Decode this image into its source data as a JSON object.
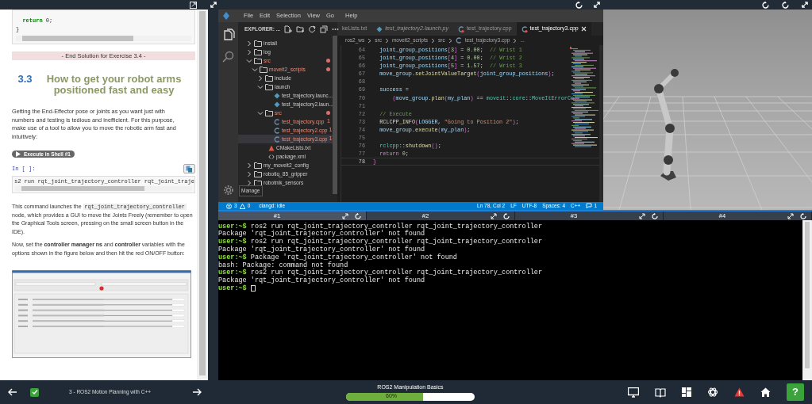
{
  "notebook": {
    "code_top": [
      [
        {
          "kind": "keyword",
          "text": "  return"
        },
        {
          "kind": "plain",
          "text": " 0;"
        }
      ],
      [
        {
          "kind": "plain",
          "text": "}"
        }
      ]
    ],
    "banner": "- End Solution for Exercise 3.4 -",
    "heading": {
      "number": "3.3",
      "title": "How to get your robot arms positioned fast and easy"
    },
    "paragraph_1": "Getting the End-Effector pose or joints as you want just with numbers and testing is tedious and inefficient. For this purpose, make use of a tool to allow you to move the robotic arm fast and intuitively:",
    "run_button": "Execute in Shell #1",
    "cell_prompt": "In [ ]:",
    "cell_code": "s2 run rqt_joint_trajectory_controller rqt_joint_traje",
    "paragraph_2": {
      "before": "This command launches the",
      "code": "rqt_joint_trajectory_controller",
      "after": "node, which provides a GUI to move the Joints Freely (remember to open the Graphical Tools screen, pressing on the small screen button in the IDE)."
    },
    "paragraph_3": "Now, set the **controller manager ns** and **controller** variables with the options shown in the figure below and then hit the red ON/OFF button:"
  },
  "ide": {
    "menu": [
      "File",
      "Edit",
      "Selection",
      "View",
      "Go",
      "Help"
    ],
    "explorer_title": "EXPLORER: ...",
    "tree": [
      {
        "label": "install",
        "kind": "folder",
        "expanded": false,
        "error": false,
        "selected": false
      },
      {
        "label": "log",
        "kind": "folder",
        "expanded": false,
        "error": false,
        "selected": false
      },
      {
        "label": "src",
        "kind": "folder",
        "expanded": true,
        "error": true,
        "selected": false,
        "children": [
          {
            "label": "moveit2_scripts",
            "kind": "folder",
            "expanded": true,
            "error": true,
            "selected": false,
            "children": [
              {
                "label": "include",
                "kind": "folder",
                "expanded": false,
                "error": false,
                "selected": false
              },
              {
                "label": "launch",
                "kind": "folder",
                "expanded": true,
                "error": false,
                "selected": false,
                "children": [
                  {
                    "label": "test_trajectory.launc...",
                    "kind": "launch",
                    "error": false,
                    "selected": false
                  },
                  {
                    "label": "test_trajectory2.laun...",
                    "kind": "launch",
                    "error": false,
                    "selected": false
                  }
                ]
              },
              {
                "label": "src",
                "kind": "folder",
                "expanded": true,
                "error": true,
                "selected": false,
                "children": [
                  {
                    "label": "test_trajectory.cpp",
                    "kind": "cpp",
                    "error": true,
                    "badge": "1",
                    "selected": false
                  },
                  {
                    "label": "test_trajectory2.cpp",
                    "kind": "cpp",
                    "error": true,
                    "badge": "1",
                    "selected": false
                  },
                  {
                    "label": "test_trajectory3.cpp",
                    "kind": "cpp",
                    "error": true,
                    "badge": "1",
                    "selected": true
                  }
                ]
              },
              {
                "label": "CMakeLists.txt",
                "kind": "cmake",
                "error": false,
                "selected": false
              },
              {
                "label": "package.xml",
                "kind": "xml",
                "error": false,
                "selected": false
              }
            ]
          }
        ]
      },
      {
        "label": "my_moveit2_config",
        "kind": "folder",
        "expanded": false,
        "error": false,
        "selected": false
      },
      {
        "label": "robotiq_85_gripper",
        "kind": "folder",
        "expanded": false,
        "error": false,
        "selected": false
      },
      {
        "label": "robotnik_sensors",
        "kind": "folder",
        "expanded": false,
        "error": false,
        "selected": false
      }
    ],
    "tooltip": "Manage",
    "tabs": [
      {
        "label": "keLists.txt",
        "preview": false,
        "selected": false
      },
      {
        "label": "test_trajectory2.launch.py",
        "kind": "launch",
        "preview": true,
        "error": false,
        "selected": false
      },
      {
        "label": "test_trajectory.cpp",
        "kind": "cpp",
        "preview": false,
        "error": true,
        "selected": false
      },
      {
        "label": "test_trajectory3.cpp",
        "kind": "cpp",
        "preview": false,
        "error": true,
        "selected": true
      }
    ],
    "breadcrumb": [
      "ros2_ws",
      "src",
      "moveit2_scripts",
      "src",
      "test_trajectory3.cpp",
      "..."
    ],
    "code": [
      {
        "number": "64",
        "current": false,
        "segments": [
          {
            "kind": "var",
            "text": "  joint_group_positions"
          },
          {
            "kind": "bracket",
            "text": "["
          },
          {
            "kind": "num",
            "text": "3"
          },
          {
            "kind": "bracket",
            "text": "]"
          },
          {
            "kind": "op",
            "text": " = "
          },
          {
            "kind": "num",
            "text": "0.00"
          },
          {
            "kind": "op",
            "text": ";  "
          },
          {
            "kind": "comment",
            "text": "// Wrist 1"
          }
        ]
      },
      {
        "number": "65",
        "current": false,
        "segments": [
          {
            "kind": "var",
            "text": "  joint_group_positions"
          },
          {
            "kind": "bracket",
            "text": "["
          },
          {
            "kind": "num",
            "text": "4"
          },
          {
            "kind": "bracket",
            "text": "]"
          },
          {
            "kind": "op",
            "text": " = "
          },
          {
            "kind": "num",
            "text": "0.00"
          },
          {
            "kind": "op",
            "text": ";  "
          },
          {
            "kind": "comment",
            "text": "// Wrist 2"
          }
        ]
      },
      {
        "number": "66",
        "current": false,
        "segments": [
          {
            "kind": "var",
            "text": "  joint_group_positions"
          },
          {
            "kind": "bracket",
            "text": "["
          },
          {
            "kind": "num",
            "text": "5"
          },
          {
            "kind": "bracket",
            "text": "]"
          },
          {
            "kind": "op",
            "text": " = "
          },
          {
            "kind": "num",
            "text": "1.57"
          },
          {
            "kind": "op",
            "text": ";  "
          },
          {
            "kind": "comment",
            "text": "// Wrist 3"
          }
        ]
      },
      {
        "number": "67",
        "current": false,
        "segments": [
          {
            "kind": "var",
            "text": "  move_group"
          },
          {
            "kind": "op",
            "text": "."
          },
          {
            "kind": "fn",
            "text": "setJointValueTarget"
          },
          {
            "kind": "bracket",
            "text": "("
          },
          {
            "kind": "var",
            "text": "joint_group_positions"
          },
          {
            "kind": "bracket",
            "text": ")"
          },
          {
            "kind": "op",
            "text": ";"
          }
        ]
      },
      {
        "number": "68",
        "current": false
      },
      {
        "number": "69",
        "current": false,
        "segments": [
          {
            "kind": "var",
            "text": "  success"
          },
          {
            "kind": "op",
            "text": " ="
          }
        ]
      },
      {
        "number": "70",
        "current": false,
        "segments": [
          {
            "kind": "bracket",
            "text": "      ("
          },
          {
            "kind": "var",
            "text": "move_group"
          },
          {
            "kind": "op",
            "text": "."
          },
          {
            "kind": "fn",
            "text": "plan"
          },
          {
            "kind": "bracket",
            "text": "("
          },
          {
            "kind": "var",
            "text": "my_plan"
          },
          {
            "kind": "bracket",
            "text": ")"
          },
          {
            "kind": "op",
            "text": " == "
          },
          {
            "kind": "ns",
            "text": "moveit"
          },
          {
            "kind": "op",
            "text": "::"
          },
          {
            "kind": "ns",
            "text": "core"
          },
          {
            "kind": "op",
            "text": "::"
          },
          {
            "kind": "ns",
            "text": "MoveItErrorCo"
          }
        ]
      },
      {
        "number": "71",
        "current": false
      },
      {
        "number": "72",
        "current": false,
        "segments": [
          {
            "kind": "comment",
            "text": "  // Execute"
          }
        ]
      },
      {
        "number": "73",
        "current": false,
        "segments": [
          {
            "kind": "fn",
            "text": "  RCLCPP_INFO"
          },
          {
            "kind": "bracket",
            "text": "("
          },
          {
            "kind": "var",
            "text": "LOGGER"
          },
          {
            "kind": "op",
            "text": ", "
          },
          {
            "kind": "string",
            "text": "\"Going to Position 2\""
          },
          {
            "kind": "bracket",
            "text": ")"
          },
          {
            "kind": "op",
            "text": ";"
          }
        ]
      },
      {
        "number": "74",
        "current": false,
        "segments": [
          {
            "kind": "var",
            "text": "  move_group"
          },
          {
            "kind": "op",
            "text": "."
          },
          {
            "kind": "fn",
            "text": "execute"
          },
          {
            "kind": "bracket",
            "text": "("
          },
          {
            "kind": "var",
            "text": "my_plan"
          },
          {
            "kind": "bracket",
            "text": ")"
          },
          {
            "kind": "op",
            "text": ";"
          }
        ]
      },
      {
        "number": "75",
        "current": false
      },
      {
        "number": "76",
        "current": false,
        "segments": [
          {
            "kind": "ns",
            "text": "  rclcpp"
          },
          {
            "kind": "op",
            "text": "::"
          },
          {
            "kind": "fn",
            "text": "shutdown"
          },
          {
            "kind": "bracket",
            "text": "()"
          },
          {
            "kind": "op",
            "text": ";"
          }
        ]
      },
      {
        "number": "77",
        "current": false,
        "segments": [
          {
            "kind": "keyword",
            "text": "  return"
          },
          {
            "kind": "num",
            "text": " 0"
          },
          {
            "kind": "op",
            "text": ";"
          }
        ]
      },
      {
        "number": "78",
        "current": true,
        "segments": [
          {
            "kind": "bracket",
            "text": "}"
          }
        ]
      }
    ],
    "status": {
      "errors": "3",
      "warnings": "0",
      "server": "clangd: idle",
      "right": [
        "Ln 78, Col 2",
        "LF",
        "UTF-8",
        "Spaces: 4",
        "C++"
      ],
      "notifications": "1"
    }
  },
  "terminal": {
    "tabs": [
      {
        "label": "#1",
        "selected": true
      },
      {
        "label": "#2",
        "selected": false
      },
      {
        "label": "#3",
        "selected": false
      },
      {
        "label": "#4",
        "selected": false
      }
    ],
    "lines": [
      {
        "prompt": "user:~$",
        "text": "ros2 run rqt_joint_trajectory_controller rqt_joint_trajectory_controller"
      },
      {
        "text": "Package 'rqt_joint_trajectory_controller' not found"
      },
      {
        "prompt": "user:~$",
        "text": "ros2 run rqt_joint_trajectory_controller rqt_joint_trajectory_controller"
      },
      {
        "text": "Package 'rqt_joint_trajectory_controller' not found"
      },
      {
        "prompt": "user:~$",
        "text": "Package 'rqt_joint_trajectory_controller' not found"
      },
      {
        "text": "bash: Package: command not found"
      },
      {
        "prompt": "user:~$",
        "text": "ros2 run rqt_joint_trajectory_controller rqt_joint_trajectory_controller"
      },
      {
        "text": "Package 'rqt_joint_trajectory_controller' not found"
      },
      {
        "prompt": "user:~$"
      }
    ],
    "cursor": true
  },
  "bottom_bar": {
    "completed": true,
    "lesson": "3 - ROS2 Motion Planning with C++",
    "course": "ROS2 Manipulation Basics",
    "progress": {
      "level": 0.6,
      "label": "60%"
    },
    "help": "?"
  }
}
